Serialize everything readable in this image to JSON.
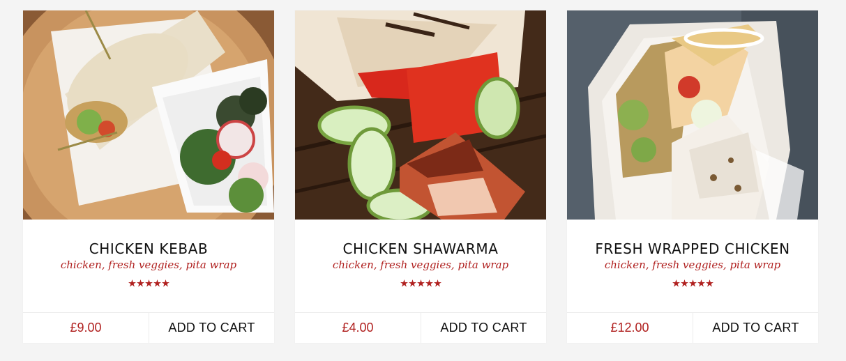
{
  "colors": {
    "accent": "#b0201f",
    "title": "#111111",
    "background": "#f4f4f4"
  },
  "products": [
    {
      "title": "CHICKEN KEBAB",
      "subtitle": "chicken, fresh veggies, pita wrap",
      "rating": 5,
      "rating_max": 5,
      "price": "£9.00",
      "cart_label": "ADD TO CART",
      "image": "chicken-kebab-wrap-photo"
    },
    {
      "title": "CHICKEN SHAWARMA",
      "subtitle": "chicken, fresh veggies, pita wrap",
      "rating": 5,
      "rating_max": 5,
      "price": "£4.00",
      "cart_label": "ADD TO CART",
      "image": "chicken-shawarma-wrap-photo"
    },
    {
      "title": "FRESH WRAPPED CHICKEN",
      "subtitle": "chicken, fresh veggies, pita wrap",
      "rating": 5,
      "rating_max": 5,
      "price": "£12.00",
      "cart_label": "ADD TO CART",
      "image": "fresh-wrapped-chicken-photo"
    }
  ]
}
